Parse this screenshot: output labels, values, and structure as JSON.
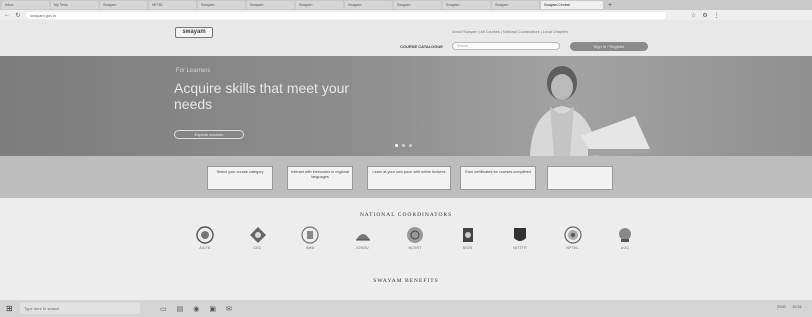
{
  "browser": {
    "tabs": [
      {
        "label": "Inbox"
      },
      {
        "label": "My Tests"
      },
      {
        "label": "Swayam"
      },
      {
        "label": "NPTEL"
      },
      {
        "label": "Swayam"
      },
      {
        "label": "Swayam"
      },
      {
        "label": "Swayam"
      },
      {
        "label": "Swayam"
      },
      {
        "label": "Swayam"
      },
      {
        "label": "Swayam"
      },
      {
        "label": "Swayam"
      },
      {
        "label": "Swayam Central",
        "active": true
      }
    ],
    "new_tab": "+",
    "url": "swayam.gov.in"
  },
  "header": {
    "logo": "swayam",
    "top_links": "About Swayam | All Courses | National Coordinators | Local Chapters",
    "catalog": "COURSE CATALOGUE",
    "search_placeholder": "Search",
    "signin": "Sign In / Register"
  },
  "hero": {
    "eyebrow": "For Learners",
    "title": "Acquire skills that meet your needs",
    "button": "Explore courses"
  },
  "info_boxes": [
    {
      "text": "Select your course category"
    },
    {
      "text": "Interact with instructors in regional languages"
    },
    {
      "text": "Learn at your own pace with online lectures"
    },
    {
      "text": "Earn certificates for courses completed"
    },
    {
      "text": ""
    }
  ],
  "coordinators": {
    "title": "NATIONAL COORDINATORS",
    "items": [
      {
        "label": "AICTE",
        "icon": "aicte-logo"
      },
      {
        "label": "CEC",
        "icon": "cec-logo"
      },
      {
        "label": "IIMB",
        "icon": "iimb-logo"
      },
      {
        "label": "IGNOU",
        "icon": "ignou-logo"
      },
      {
        "label": "NCERT",
        "icon": "ncert-logo"
      },
      {
        "label": "NIOS",
        "icon": "nios-logo"
      },
      {
        "label": "NITTTR",
        "icon": "nitttr-logo"
      },
      {
        "label": "NPTEL",
        "icon": "nptel-logo"
      },
      {
        "label": "UGC",
        "icon": "ugc-logo"
      }
    ]
  },
  "benefits": {
    "title": "SWAYAM BENEFITS"
  },
  "taskbar": {
    "search": "Type here to search",
    "tray": "ENG",
    "time": "10:51"
  }
}
